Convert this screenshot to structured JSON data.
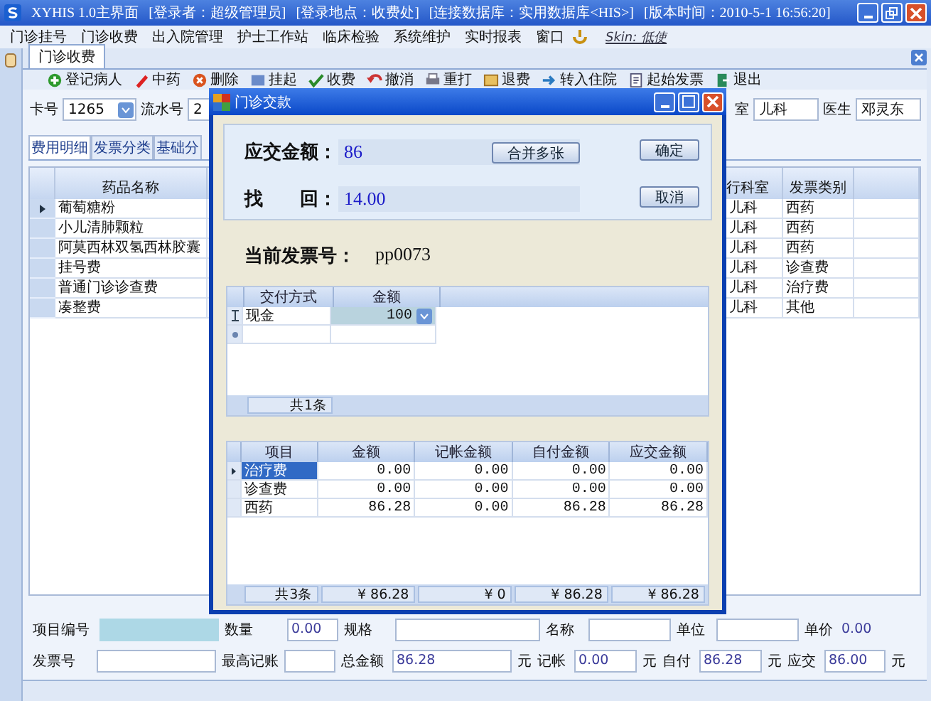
{
  "window": {
    "title_parts": [
      "XYHIS 1.0主界面",
      "[登录者：超级管理员]",
      "[登录地点：收费处]",
      "[连接数据库：实用数据库<HIS>]",
      "[版本时间：2010-5-1 16:56:20]"
    ]
  },
  "menu": [
    "门诊挂号",
    "门诊收费",
    "出入院管理",
    "护士工作站",
    "临床检验",
    "系统维护",
    "实时报表",
    "窗口"
  ],
  "skin": "Skin: 低使",
  "tabs": [
    {
      "label": "门诊收费",
      "selected": true
    }
  ],
  "toolbar": [
    {
      "label": "登记病人",
      "kind": "add"
    },
    {
      "label": "中药",
      "kind": "pen"
    },
    {
      "label": "删除",
      "kind": "delete"
    },
    {
      "label": "挂起",
      "kind": "pause"
    },
    {
      "label": "收费",
      "kind": "check"
    },
    {
      "label": "撤消",
      "kind": "undo"
    },
    {
      "label": "重打",
      "kind": "print"
    },
    {
      "label": "退费",
      "kind": "refund"
    },
    {
      "label": "转入住院",
      "kind": "transfer"
    },
    {
      "label": "起始发票",
      "kind": "invoice"
    },
    {
      "label": "退出",
      "kind": "exit"
    }
  ],
  "patient_left": [
    {
      "label": "卡号",
      "value": "1265",
      "kind": "combo"
    },
    {
      "label": "流水号",
      "value": "2",
      "kind": "text"
    }
  ],
  "patient_right": [
    {
      "label": "室",
      "value": "儿科",
      "kind": "text"
    },
    {
      "label": "医生",
      "value": "邓灵东",
      "kind": "text"
    }
  ],
  "inner_tabs": [
    {
      "label": "费用明细",
      "selected": true
    },
    {
      "label": "发票分类",
      "selected": false
    },
    {
      "label": "基础分",
      "selected": false
    }
  ],
  "items_table": {
    "columns": [
      "药品名称",
      "行科室",
      "发票类别"
    ],
    "rows": [
      {
        "name": "葡萄糖粉",
        "dept": "儿科",
        "category": "西药",
        "current": true
      },
      {
        "name": "小儿清肺颗粒",
        "dept": "儿科",
        "category": "西药",
        "current": false
      },
      {
        "name": "阿莫西林双氢西林胶囊",
        "dept": "儿科",
        "category": "西药",
        "current": false
      },
      {
        "name": "挂号费",
        "dept": "儿科",
        "category": "诊查费",
        "current": false
      },
      {
        "name": "普通门诊诊查费",
        "dept": "儿科",
        "category": "治疗费",
        "current": false
      },
      {
        "name": "凑整费",
        "dept": "儿科",
        "category": "其他",
        "current": false
      }
    ]
  },
  "dialog": {
    "title": "门诊交款",
    "due_label": "应交金额：",
    "due_value": "86",
    "change_label": "找　　回：",
    "change_value": "14.00",
    "buttons": [
      {
        "label": "合并多张",
        "kind": "merge"
      },
      {
        "label": "确定",
        "kind": "ok"
      },
      {
        "label": "取消",
        "kind": "cancel"
      }
    ],
    "invoice_label": "当前发票号：",
    "invoice_value": "pp0073",
    "payments": {
      "columns": [
        "交付方式",
        "金额"
      ],
      "rows": [
        {
          "method": "现金",
          "amount": "100"
        }
      ],
      "footer": "共1条"
    },
    "summary": {
      "columns": [
        "项目",
        "金额",
        "记帐金额",
        "自付金额",
        "应交金额"
      ],
      "rows": [
        {
          "cells": [
            "治疗费",
            "0.00",
            "0.00",
            "0.00",
            "0.00"
          ],
          "selected": true
        },
        {
          "cells": [
            "诊查费",
            "0.00",
            "0.00",
            "0.00",
            "0.00"
          ],
          "selected": false
        },
        {
          "cells": [
            "西药",
            "86.28",
            "0.00",
            "86.28",
            "86.28"
          ],
          "selected": false
        }
      ],
      "footer": [
        "共3条",
        "¥ 86.28",
        "¥ 0",
        "¥ 86.28",
        "¥ 86.28"
      ]
    }
  },
  "form_rows": [
    [
      {
        "label": "项目编号",
        "kind": "readonly"
      },
      {
        "label": "数量",
        "value": "0.00",
        "kind": "field"
      },
      {
        "label": "规格",
        "kind": "field"
      },
      {
        "label": "名称",
        "kind": "field"
      },
      {
        "label": "单位",
        "kind": "field"
      },
      {
        "label": "单价",
        "value": "0.00",
        "kind": "plain"
      }
    ],
    [
      {
        "label": "发票号",
        "kind": "field"
      },
      {
        "label": "最高记账",
        "kind": "field"
      },
      {
        "label": "总金额",
        "value": "86.28",
        "kind": "field",
        "unit": "元"
      },
      {
        "label": "记帐",
        "value": "0.00",
        "kind": "field",
        "unit": "元"
      },
      {
        "label": "自付",
        "value": "86.28",
        "kind": "field",
        "unit": "元"
      },
      {
        "label": "应交",
        "value": "86.00",
        "kind": "field",
        "unit": "元"
      }
    ]
  ]
}
